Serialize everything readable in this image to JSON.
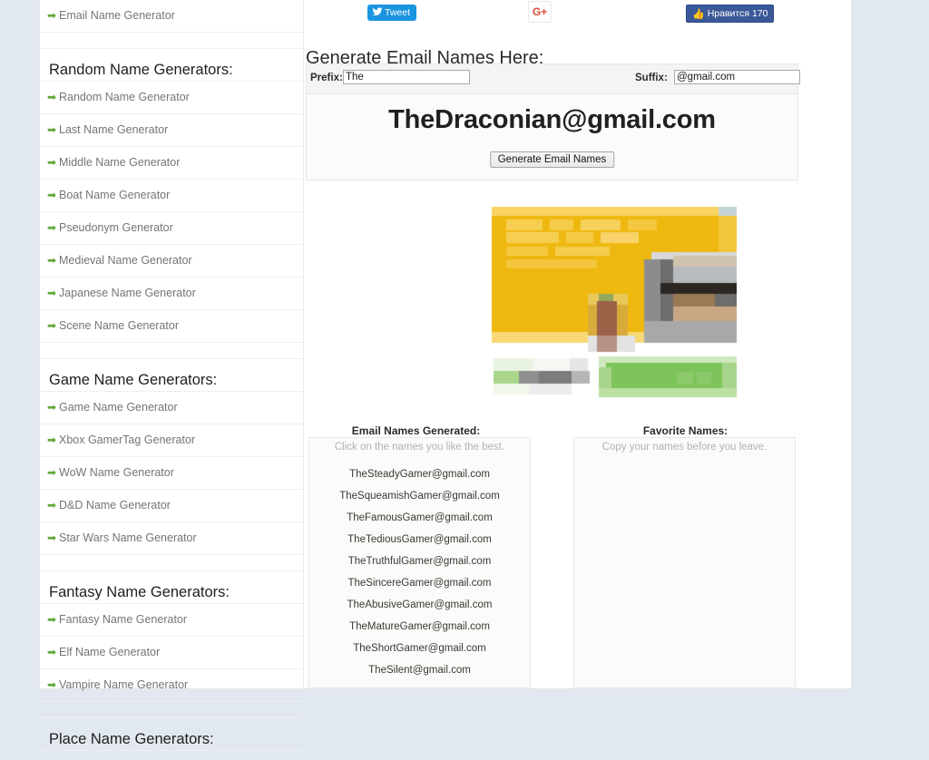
{
  "sidebar": {
    "top_orphan_item": {
      "label": "Email Name Generator",
      "icon": "arrow-right-icon"
    },
    "sections": [
      {
        "heading": "Random Name Generators:",
        "items": [
          {
            "label": "Random Name Generator",
            "icon": "arrow-right-icon"
          },
          {
            "label": "Last Name Generator",
            "icon": "arrow-right-icon"
          },
          {
            "label": "Middle Name Generator",
            "icon": "arrow-right-icon"
          },
          {
            "label": "Boat Name Generator",
            "icon": "arrow-right-icon"
          },
          {
            "label": "Pseudonym Generator",
            "icon": "arrow-right-icon"
          },
          {
            "label": "Medieval Name Generator",
            "icon": "arrow-right-icon"
          },
          {
            "label": "Japanese Name Generator",
            "icon": "arrow-right-icon"
          },
          {
            "label": "Scene Name Generator",
            "icon": "arrow-right-icon"
          }
        ]
      },
      {
        "heading": "Game Name Generators:",
        "items": [
          {
            "label": "Game Name Generator",
            "icon": "arrow-right-icon"
          },
          {
            "label": "Xbox GamerTag Generator",
            "icon": "arrow-right-icon"
          },
          {
            "label": "WoW Name Generator",
            "icon": "arrow-right-icon"
          },
          {
            "label": "D&D Name Generator",
            "icon": "arrow-right-icon"
          },
          {
            "label": "Star Wars Name Generator",
            "icon": "arrow-right-icon"
          }
        ]
      },
      {
        "heading": "Fantasy Name Generators:",
        "items": [
          {
            "label": "Fantasy Name Generator",
            "icon": "arrow-right-icon"
          },
          {
            "label": "Elf Name Generator",
            "icon": "arrow-right-icon"
          },
          {
            "label": "Vampire Name Generator",
            "icon": "arrow-right-icon"
          }
        ]
      },
      {
        "heading": "Place Name Generators:",
        "items": []
      }
    ]
  },
  "social": {
    "tweet_label": "Tweet",
    "tweet_icon": "twitter-bird-icon",
    "tweet_color": "#1b95e0",
    "gplus_label": "G+",
    "gplus_icon": "google-plus-icon",
    "gplus_color": "#dd4b39",
    "facebook_label": "Нравится 170",
    "facebook_icon": "thumbs-up-icon",
    "facebook_color": "#3b5998",
    "facebook_count": "170"
  },
  "main": {
    "heading": "Generate Email Names Here:",
    "form": {
      "prefix_label": "Prefix:",
      "prefix_value": "The",
      "suffix_label": "Suffix:",
      "suffix_value": "@gmail.com",
      "result": "TheDraconian@gmail.com",
      "generate_button": "Generate Email Names"
    },
    "results": {
      "generated_title": "Email Names Generated:",
      "generated_hint": "Click on the names you like the best.",
      "generated_names": [
        "TheSteadyGamer@gmail.com",
        "TheSqueamishGamer@gmail.com",
        "TheFamousGamer@gmail.com",
        "TheTediousGamer@gmail.com",
        "TheTruthfulGamer@gmail.com",
        "TheSincereGamer@gmail.com",
        "TheAbusiveGamer@gmail.com",
        "TheMatureGamer@gmail.com",
        "TheShortGamer@gmail.com",
        "TheSilent@gmail.com"
      ],
      "favorites_title": "Favorite Names:",
      "favorites_hint": "Copy your names before you leave.",
      "favorites": []
    },
    "advertisement": {
      "name": "pixelated-banner-ad",
      "primary_color": "#efb810",
      "accent_color": "#7cc35a"
    }
  },
  "theme": {
    "page_background": "#e2e8ef",
    "content_background": "#ffffff",
    "link_color": "#757575",
    "arrow_color": "#63a83b"
  }
}
